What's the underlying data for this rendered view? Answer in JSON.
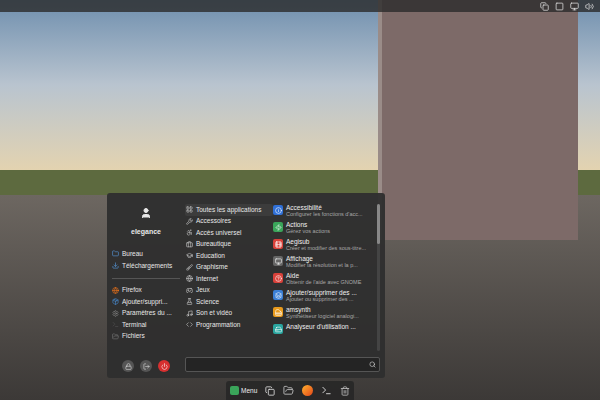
{
  "menu": {
    "user": {
      "name": "elegance"
    },
    "places": [
      {
        "label": "Bureau"
      },
      {
        "label": "Téléchargements"
      }
    ],
    "favorites": [
      {
        "label": "Firefox"
      },
      {
        "label": "Ajouter/suppri..."
      },
      {
        "label": "Paramètres du ..."
      },
      {
        "label": "Terminal"
      },
      {
        "label": "Fichiers"
      }
    ],
    "categories": [
      {
        "label": "Toutes les applications",
        "selected": true
      },
      {
        "label": "Accessoires",
        "selected": false
      },
      {
        "label": "Accès universel",
        "selected": false
      },
      {
        "label": "Bureautique",
        "selected": false
      },
      {
        "label": "Education",
        "selected": false
      },
      {
        "label": "Graphisme",
        "selected": false
      },
      {
        "label": "Internet",
        "selected": false
      },
      {
        "label": "Jeux",
        "selected": false
      },
      {
        "label": "Science",
        "selected": false
      },
      {
        "label": "Son et vidéo",
        "selected": false
      },
      {
        "label": "Programmation",
        "selected": false
      }
    ],
    "apps": [
      {
        "name": "Accessibilité",
        "description": "Configurer les fonctions d'acc..."
      },
      {
        "name": "Actions",
        "description": "Gérez vos actions"
      },
      {
        "name": "Aegisub",
        "description": "Créer et modifier des sous-titre..."
      },
      {
        "name": "Affichage",
        "description": "Modifier la résolution et la p..."
      },
      {
        "name": "Aide",
        "description": "Obtenir de l'aide avec GNOME"
      },
      {
        "name": "Ajouter/supprimer des ...",
        "description": "Ajouter ou supprimer des ..."
      },
      {
        "name": "amsynth",
        "description": "Synthétiseur logiciel analogi..."
      },
      {
        "name": "Analyseur d'utilisation ...",
        "description": ""
      }
    ],
    "search": {
      "placeholder": ""
    }
  },
  "taskbar": {
    "menu_label": "Menu"
  }
}
